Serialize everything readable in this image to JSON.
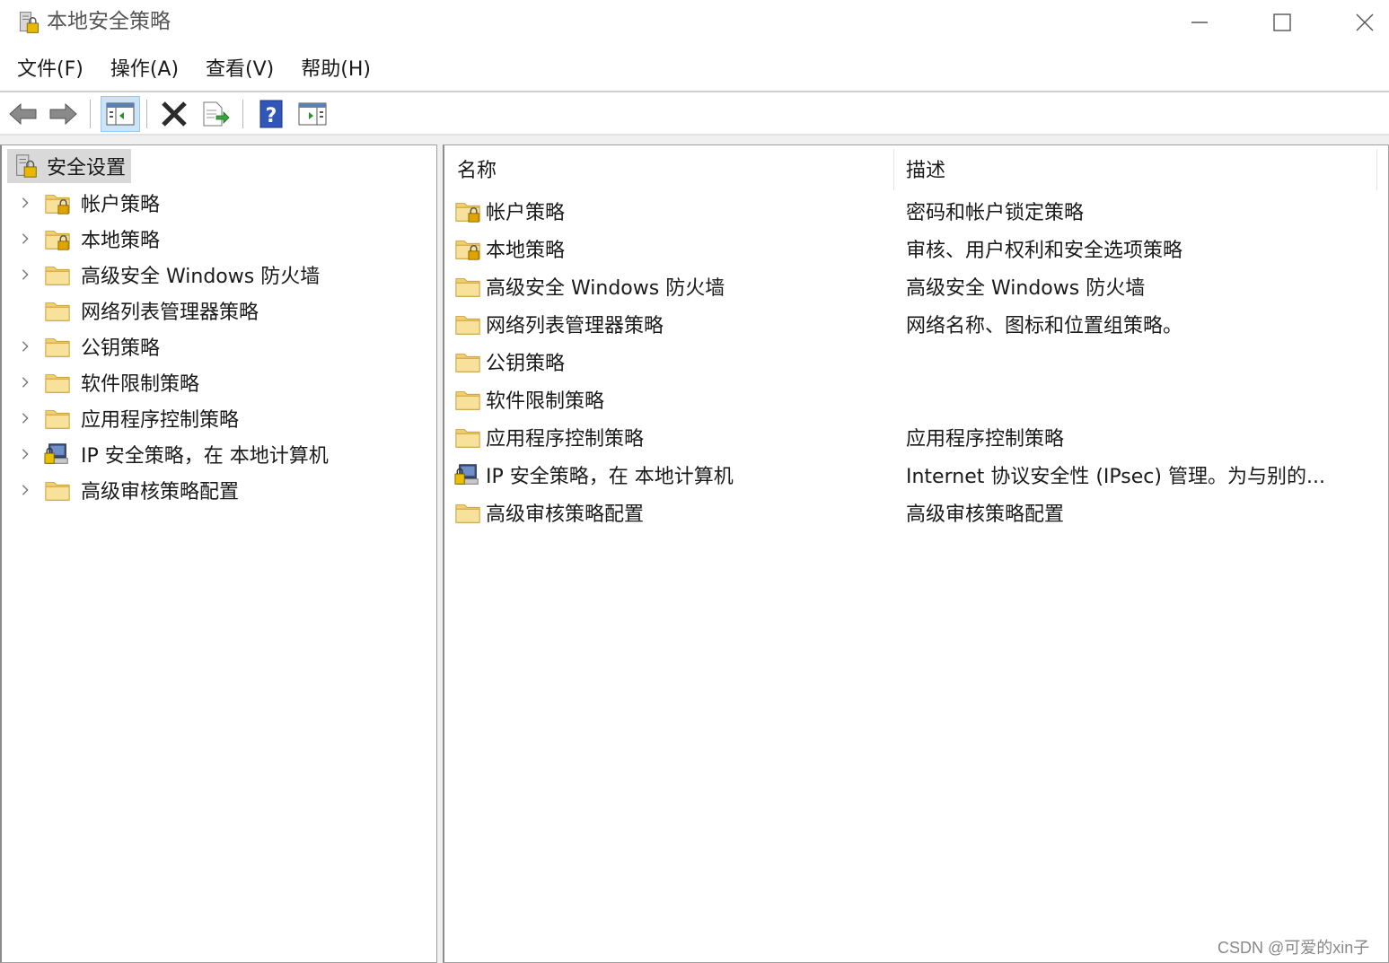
{
  "window": {
    "title": "本地安全策略"
  },
  "menu": [
    {
      "label": "文件(F)"
    },
    {
      "label": "操作(A)"
    },
    {
      "label": "查看(V)"
    },
    {
      "label": "帮助(H)"
    }
  ],
  "toolbar": {
    "icons": [
      "back-arrow-icon",
      "forward-arrow-icon",
      "show-hide-console-tree-icon",
      "delete-icon",
      "export-list-icon",
      "help-icon",
      "action-pane-icon"
    ]
  },
  "tree": {
    "root": {
      "label": "安全设置",
      "icon": "security-settings-icon"
    },
    "items": [
      {
        "label": "帐户策略",
        "icon": "locked-folder-icon",
        "expandable": true
      },
      {
        "label": "本地策略",
        "icon": "locked-folder-icon",
        "expandable": true
      },
      {
        "label": "高级安全 Windows 防火墙",
        "icon": "folder-icon",
        "expandable": true
      },
      {
        "label": "网络列表管理器策略",
        "icon": "folder-icon",
        "expandable": false
      },
      {
        "label": "公钥策略",
        "icon": "folder-icon",
        "expandable": true
      },
      {
        "label": "软件限制策略",
        "icon": "folder-icon",
        "expandable": true
      },
      {
        "label": "应用程序控制策略",
        "icon": "folder-icon",
        "expandable": true
      },
      {
        "label": "IP 安全策略，在 本地计算机",
        "icon": "ip-security-icon",
        "expandable": true
      },
      {
        "label": "高级审核策略配置",
        "icon": "folder-icon",
        "expandable": true
      }
    ]
  },
  "list": {
    "columns": {
      "name": "名称",
      "desc": "描述"
    },
    "rows": [
      {
        "name": "帐户策略",
        "desc": "密码和帐户锁定策略",
        "icon": "locked-folder-icon"
      },
      {
        "name": "本地策略",
        "desc": "审核、用户权利和安全选项策略",
        "icon": "locked-folder-icon"
      },
      {
        "name": "高级安全 Windows 防火墙",
        "desc": "高级安全 Windows 防火墙",
        "icon": "folder-icon"
      },
      {
        "name": "网络列表管理器策略",
        "desc": "网络名称、图标和位置组策略。",
        "icon": "folder-icon"
      },
      {
        "name": "公钥策略",
        "desc": "",
        "icon": "folder-icon"
      },
      {
        "name": "软件限制策略",
        "desc": "",
        "icon": "folder-icon"
      },
      {
        "name": "应用程序控制策略",
        "desc": "应用程序控制策略",
        "icon": "folder-icon"
      },
      {
        "name": "IP 安全策略，在 本地计算机",
        "desc": "Internet 协议安全性 (IPsec) 管理。为与别的...",
        "icon": "ip-security-icon"
      },
      {
        "name": "高级审核策略配置",
        "desc": "高级审核策略配置",
        "icon": "folder-icon"
      }
    ]
  },
  "watermark": "CSDN @可爱的xin子",
  "colors": {
    "folder": "#f5d77a",
    "folder_dark": "#d9b24a",
    "selection": "#d9d9d9",
    "toolbar_pressed": "#cce4f7"
  }
}
